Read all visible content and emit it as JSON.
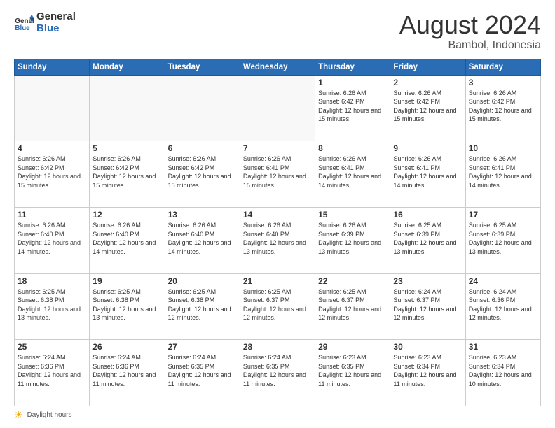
{
  "header": {
    "logo_general": "General",
    "logo_blue": "Blue",
    "month_year": "August 2024",
    "location": "Bambol, Indonesia"
  },
  "footer": {
    "label": "Daylight hours"
  },
  "days_of_week": [
    "Sunday",
    "Monday",
    "Tuesday",
    "Wednesday",
    "Thursday",
    "Friday",
    "Saturday"
  ],
  "weeks": [
    [
      {
        "day": "",
        "sunrise": "",
        "sunset": "",
        "daylight": "",
        "empty": true
      },
      {
        "day": "",
        "sunrise": "",
        "sunset": "",
        "daylight": "",
        "empty": true
      },
      {
        "day": "",
        "sunrise": "",
        "sunset": "",
        "daylight": "",
        "empty": true
      },
      {
        "day": "",
        "sunrise": "",
        "sunset": "",
        "daylight": "",
        "empty": true
      },
      {
        "day": "1",
        "sunrise": "Sunrise: 6:26 AM",
        "sunset": "Sunset: 6:42 PM",
        "daylight": "Daylight: 12 hours and 15 minutes.",
        "empty": false
      },
      {
        "day": "2",
        "sunrise": "Sunrise: 6:26 AM",
        "sunset": "Sunset: 6:42 PM",
        "daylight": "Daylight: 12 hours and 15 minutes.",
        "empty": false
      },
      {
        "day": "3",
        "sunrise": "Sunrise: 6:26 AM",
        "sunset": "Sunset: 6:42 PM",
        "daylight": "Daylight: 12 hours and 15 minutes.",
        "empty": false
      }
    ],
    [
      {
        "day": "4",
        "sunrise": "Sunrise: 6:26 AM",
        "sunset": "Sunset: 6:42 PM",
        "daylight": "Daylight: 12 hours and 15 minutes.",
        "empty": false
      },
      {
        "day": "5",
        "sunrise": "Sunrise: 6:26 AM",
        "sunset": "Sunset: 6:42 PM",
        "daylight": "Daylight: 12 hours and 15 minutes.",
        "empty": false
      },
      {
        "day": "6",
        "sunrise": "Sunrise: 6:26 AM",
        "sunset": "Sunset: 6:42 PM",
        "daylight": "Daylight: 12 hours and 15 minutes.",
        "empty": false
      },
      {
        "day": "7",
        "sunrise": "Sunrise: 6:26 AM",
        "sunset": "Sunset: 6:41 PM",
        "daylight": "Daylight: 12 hours and 15 minutes.",
        "empty": false
      },
      {
        "day": "8",
        "sunrise": "Sunrise: 6:26 AM",
        "sunset": "Sunset: 6:41 PM",
        "daylight": "Daylight: 12 hours and 14 minutes.",
        "empty": false
      },
      {
        "day": "9",
        "sunrise": "Sunrise: 6:26 AM",
        "sunset": "Sunset: 6:41 PM",
        "daylight": "Daylight: 12 hours and 14 minutes.",
        "empty": false
      },
      {
        "day": "10",
        "sunrise": "Sunrise: 6:26 AM",
        "sunset": "Sunset: 6:41 PM",
        "daylight": "Daylight: 12 hours and 14 minutes.",
        "empty": false
      }
    ],
    [
      {
        "day": "11",
        "sunrise": "Sunrise: 6:26 AM",
        "sunset": "Sunset: 6:40 PM",
        "daylight": "Daylight: 12 hours and 14 minutes.",
        "empty": false
      },
      {
        "day": "12",
        "sunrise": "Sunrise: 6:26 AM",
        "sunset": "Sunset: 6:40 PM",
        "daylight": "Daylight: 12 hours and 14 minutes.",
        "empty": false
      },
      {
        "day": "13",
        "sunrise": "Sunrise: 6:26 AM",
        "sunset": "Sunset: 6:40 PM",
        "daylight": "Daylight: 12 hours and 14 minutes.",
        "empty": false
      },
      {
        "day": "14",
        "sunrise": "Sunrise: 6:26 AM",
        "sunset": "Sunset: 6:40 PM",
        "daylight": "Daylight: 12 hours and 13 minutes.",
        "empty": false
      },
      {
        "day": "15",
        "sunrise": "Sunrise: 6:26 AM",
        "sunset": "Sunset: 6:39 PM",
        "daylight": "Daylight: 12 hours and 13 minutes.",
        "empty": false
      },
      {
        "day": "16",
        "sunrise": "Sunrise: 6:25 AM",
        "sunset": "Sunset: 6:39 PM",
        "daylight": "Daylight: 12 hours and 13 minutes.",
        "empty": false
      },
      {
        "day": "17",
        "sunrise": "Sunrise: 6:25 AM",
        "sunset": "Sunset: 6:39 PM",
        "daylight": "Daylight: 12 hours and 13 minutes.",
        "empty": false
      }
    ],
    [
      {
        "day": "18",
        "sunrise": "Sunrise: 6:25 AM",
        "sunset": "Sunset: 6:38 PM",
        "daylight": "Daylight: 12 hours and 13 minutes.",
        "empty": false
      },
      {
        "day": "19",
        "sunrise": "Sunrise: 6:25 AM",
        "sunset": "Sunset: 6:38 PM",
        "daylight": "Daylight: 12 hours and 13 minutes.",
        "empty": false
      },
      {
        "day": "20",
        "sunrise": "Sunrise: 6:25 AM",
        "sunset": "Sunset: 6:38 PM",
        "daylight": "Daylight: 12 hours and 12 minutes.",
        "empty": false
      },
      {
        "day": "21",
        "sunrise": "Sunrise: 6:25 AM",
        "sunset": "Sunset: 6:37 PM",
        "daylight": "Daylight: 12 hours and 12 minutes.",
        "empty": false
      },
      {
        "day": "22",
        "sunrise": "Sunrise: 6:25 AM",
        "sunset": "Sunset: 6:37 PM",
        "daylight": "Daylight: 12 hours and 12 minutes.",
        "empty": false
      },
      {
        "day": "23",
        "sunrise": "Sunrise: 6:24 AM",
        "sunset": "Sunset: 6:37 PM",
        "daylight": "Daylight: 12 hours and 12 minutes.",
        "empty": false
      },
      {
        "day": "24",
        "sunrise": "Sunrise: 6:24 AM",
        "sunset": "Sunset: 6:36 PM",
        "daylight": "Daylight: 12 hours and 12 minutes.",
        "empty": false
      }
    ],
    [
      {
        "day": "25",
        "sunrise": "Sunrise: 6:24 AM",
        "sunset": "Sunset: 6:36 PM",
        "daylight": "Daylight: 12 hours and 11 minutes.",
        "empty": false
      },
      {
        "day": "26",
        "sunrise": "Sunrise: 6:24 AM",
        "sunset": "Sunset: 6:36 PM",
        "daylight": "Daylight: 12 hours and 11 minutes.",
        "empty": false
      },
      {
        "day": "27",
        "sunrise": "Sunrise: 6:24 AM",
        "sunset": "Sunset: 6:35 PM",
        "daylight": "Daylight: 12 hours and 11 minutes.",
        "empty": false
      },
      {
        "day": "28",
        "sunrise": "Sunrise: 6:24 AM",
        "sunset": "Sunset: 6:35 PM",
        "daylight": "Daylight: 12 hours and 11 minutes.",
        "empty": false
      },
      {
        "day": "29",
        "sunrise": "Sunrise: 6:23 AM",
        "sunset": "Sunset: 6:35 PM",
        "daylight": "Daylight: 12 hours and 11 minutes.",
        "empty": false
      },
      {
        "day": "30",
        "sunrise": "Sunrise: 6:23 AM",
        "sunset": "Sunset: 6:34 PM",
        "daylight": "Daylight: 12 hours and 11 minutes.",
        "empty": false
      },
      {
        "day": "31",
        "sunrise": "Sunrise: 6:23 AM",
        "sunset": "Sunset: 6:34 PM",
        "daylight": "Daylight: 12 hours and 10 minutes.",
        "empty": false
      }
    ]
  ]
}
